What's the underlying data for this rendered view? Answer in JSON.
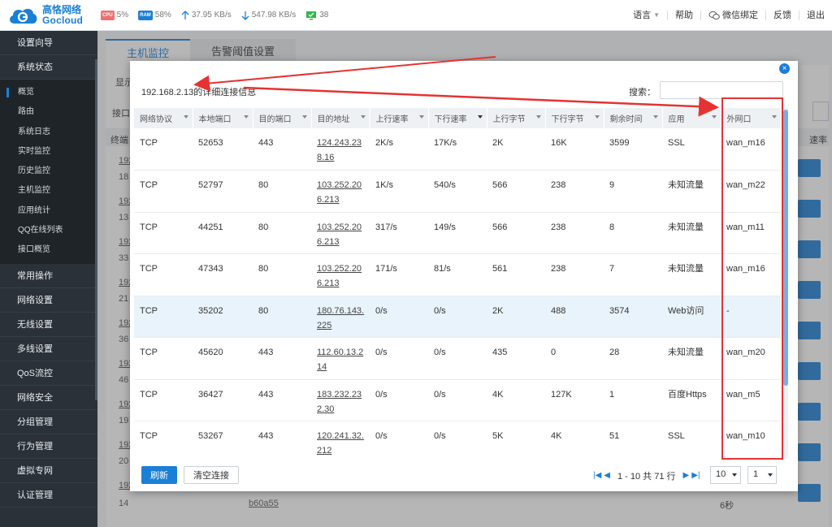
{
  "brand": {
    "name_cn": "高恪网络",
    "name_en": "Gocloud"
  },
  "status_bar": {
    "cpu_chip": "CPU",
    "cpu": "5%",
    "ram_chip": "RAM",
    "ram": "58%",
    "upload": "37.95 KB/s",
    "download": "547.98 KB/s",
    "online": "38"
  },
  "top_nav": {
    "language": "语言",
    "help": "帮助",
    "wechat": "微信绑定",
    "feedback": "反馈",
    "logout": "退出"
  },
  "sidebar": {
    "groups_top": [
      {
        "label": "设置向导"
      },
      {
        "label": "系统状态"
      }
    ],
    "sub_items": [
      {
        "label": "概览"
      },
      {
        "label": "路由"
      },
      {
        "label": "系统日志"
      },
      {
        "label": "实时监控"
      },
      {
        "label": "历史监控"
      },
      {
        "label": "主机监控"
      },
      {
        "label": "应用统计"
      },
      {
        "label": "QQ在线列表"
      },
      {
        "label": "接口概览"
      }
    ],
    "groups_bottom": [
      {
        "label": "常用操作"
      },
      {
        "label": "网络设置"
      },
      {
        "label": "无线设置"
      },
      {
        "label": "多线设置"
      },
      {
        "label": "QoS流控"
      },
      {
        "label": "网络安全"
      },
      {
        "label": "分组管理"
      },
      {
        "label": "行为管理"
      },
      {
        "label": "虚拟专网"
      },
      {
        "label": "认证管理"
      }
    ]
  },
  "page": {
    "tabs": [
      {
        "label": "主机监控"
      },
      {
        "label": "告警阈值设置"
      }
    ],
    "bg_label_show": "显示",
    "bg_label_iface": "接口",
    "bg_label_term": "终端",
    "bg_label_rate": "速率",
    "bg_rows": [
      "192.1",
      "18",
      "192.1",
      "13",
      "192.1",
      "33",
      "192.1",
      "21",
      "192.1",
      "36",
      "192.1",
      "46",
      "192.1",
      "19",
      "192.1",
      "20",
      "192.1",
      "14"
    ],
    "bg_row_mac": "b60a55",
    "bg_row_time": "6秒"
  },
  "modal": {
    "title": "192.168.2.13的详细连接信息",
    "close": "×",
    "search_label": "搜索：",
    "search_value": "",
    "columns": [
      "网络协议",
      "本地端口",
      "目的端口",
      "目的地址",
      "上行速率",
      "下行速率",
      "上行字节",
      "下行字节",
      "剩余时间",
      "应用",
      "外网口"
    ],
    "rows": [
      {
        "proto": "TCP",
        "lport": "52653",
        "dport": "443",
        "addr1": "124.243.23",
        "addr2": "8.16",
        "up": "2K/s",
        "down": "17K/s",
        "upb": "2K",
        "downb": "16K",
        "ttl": "3599",
        "app": "SSL",
        "wan": "wan_m16"
      },
      {
        "proto": "TCP",
        "lport": "52797",
        "dport": "80",
        "addr1": "103.252.20",
        "addr2": "6.213",
        "up": "1K/s",
        "down": "540/s",
        "upb": "566",
        "downb": "238",
        "ttl": "9",
        "app": "未知流量",
        "wan": "wan_m22"
      },
      {
        "proto": "TCP",
        "lport": "44251",
        "dport": "80",
        "addr1": "103.252.20",
        "addr2": "6.213",
        "up": "317/s",
        "down": "149/s",
        "upb": "566",
        "downb": "238",
        "ttl": "8",
        "app": "未知流量",
        "wan": "wan_m11"
      },
      {
        "proto": "TCP",
        "lport": "47343",
        "dport": "80",
        "addr1": "103.252.20",
        "addr2": "6.213",
        "up": "171/s",
        "down": "81/s",
        "upb": "561",
        "downb": "238",
        "ttl": "7",
        "app": "未知流量",
        "wan": "wan_m16"
      },
      {
        "proto": "TCP",
        "lport": "35202",
        "dport": "80",
        "addr1": "180.76.143.",
        "addr2": "225",
        "up": "0/s",
        "down": "0/s",
        "upb": "2K",
        "downb": "488",
        "ttl": "3574",
        "app": "Web访问",
        "wan": "-"
      },
      {
        "proto": "TCP",
        "lport": "45620",
        "dport": "443",
        "addr1": "112.60.13.2",
        "addr2": "14",
        "up": "0/s",
        "down": "0/s",
        "upb": "435",
        "downb": "0",
        "ttl": "28",
        "app": "未知流量",
        "wan": "wan_m20"
      },
      {
        "proto": "TCP",
        "lport": "36427",
        "dport": "443",
        "addr1": "183.232.23",
        "addr2": "2.30",
        "up": "0/s",
        "down": "0/s",
        "upb": "4K",
        "downb": "127K",
        "ttl": "1",
        "app": "百度Https",
        "wan": "wan_m5"
      },
      {
        "proto": "TCP",
        "lport": "53267",
        "dport": "443",
        "addr1": "120.241.32.",
        "addr2": "212",
        "up": "0/s",
        "down": "0/s",
        "upb": "5K",
        "downb": "4K",
        "ttl": "51",
        "app": "SSL",
        "wan": "wan_m10"
      }
    ],
    "refresh": "刷新",
    "clear": "清空连接",
    "pager_info": "1 - 10 共 71 行",
    "page_size": "10",
    "page_no": "1"
  },
  "colors": {
    "accent": "#1a7fd6",
    "annotation": "#e53333",
    "sidebar": "#2b3138"
  }
}
